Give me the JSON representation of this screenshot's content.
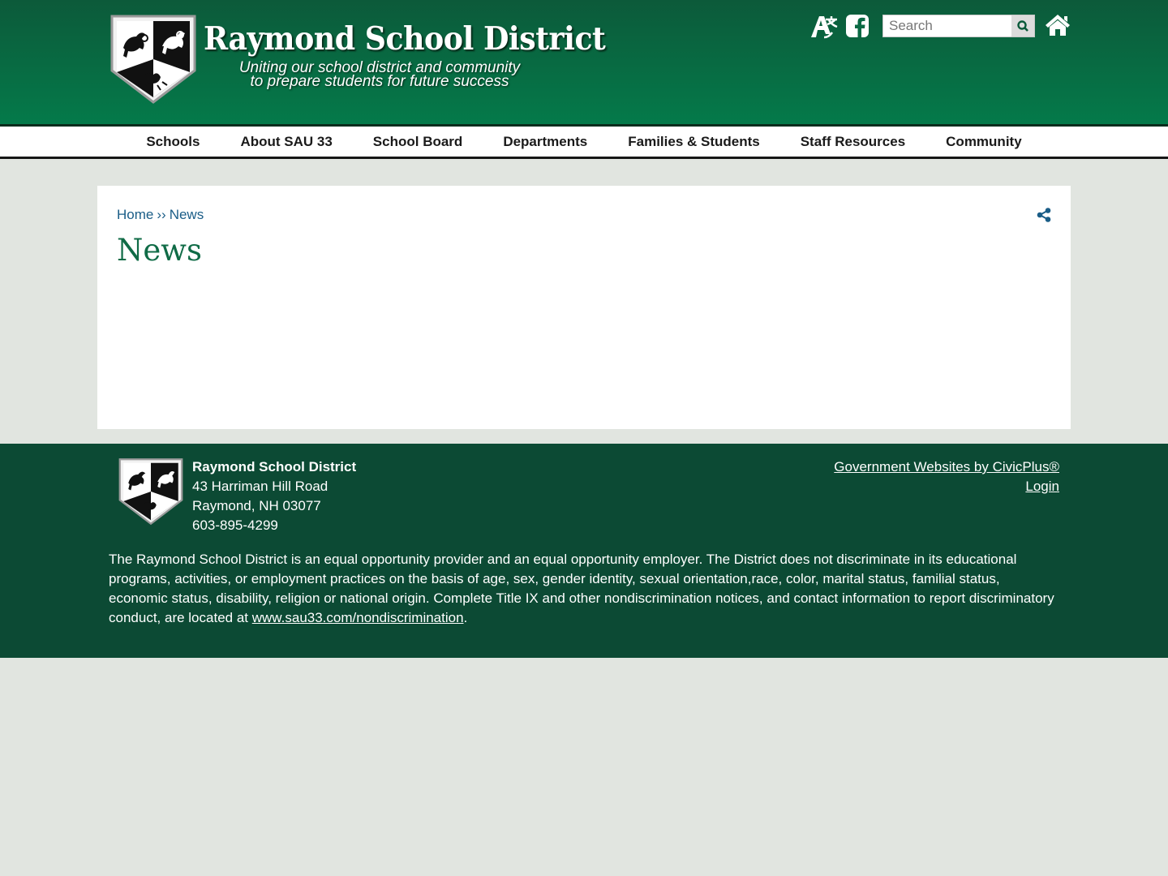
{
  "header": {
    "title": "Raymond School District",
    "tagline_line1": "Uniting our school district and community",
    "tagline_line2": "to prepare students for future success",
    "logo_icon": "district-crest-icon",
    "translate_icon": "translate-icon",
    "facebook_icon": "facebook-icon",
    "search_placeholder": "Search",
    "search_icon": "search-icon",
    "home_icon": "home-icon"
  },
  "nav": {
    "items": [
      {
        "label": "Schools"
      },
      {
        "label": "About SAU 33"
      },
      {
        "label": "School Board"
      },
      {
        "label": "Departments"
      },
      {
        "label": "Families & Students"
      },
      {
        "label": "Staff Resources"
      },
      {
        "label": "Community"
      }
    ]
  },
  "breadcrumb": {
    "home": "Home",
    "separator": "››",
    "current": "News"
  },
  "page": {
    "title": "News",
    "share_icon": "share-icon"
  },
  "footer": {
    "org_name": "Raymond School District",
    "address_line1": "43 Harriman Hill Road",
    "address_line2": "Raymond, NH 03077",
    "phone": "603-895-4299",
    "civicplus_link": "Government Websites by CivicPlus®",
    "login_link": "Login",
    "disclaimer": "The Raymond School District is an equal opportunity provider and an equal opportunity employer. The District does not discriminate in its educational programs, activities, or employment practices on the basis of age, sex, gender identity, sexual orientation,race, color, marital status, familial status, economic status, disability, religion or national origin. Complete Title IX and other nondiscrimination notices, and contact information to report discriminatory conduct, are located at",
    "disclaimer_link": "www.sau33.com/nondiscrimination",
    "disclaimer_end": "."
  },
  "colors": {
    "header_top": "#0c5a3a",
    "header_bottom": "#047a4a",
    "footer_bg": "#0c4a34",
    "title_green": "#0f6b46",
    "link_blue": "#1a5d87",
    "page_bg": "#e1e5e0"
  }
}
